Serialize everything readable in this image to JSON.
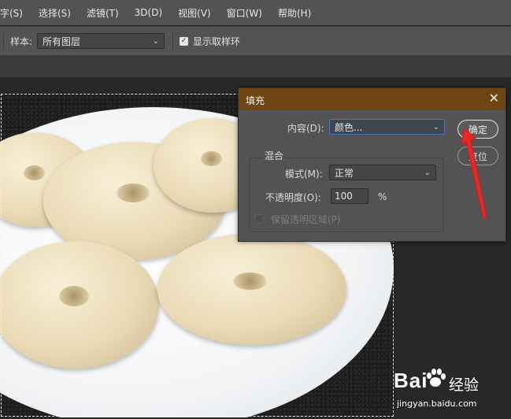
{
  "menubar": {
    "items": [
      {
        "label": "字(S)"
      },
      {
        "label": "选择(S)"
      },
      {
        "label": "滤镜(T)"
      },
      {
        "label": "3D(D)"
      },
      {
        "label": "视图(V)"
      },
      {
        "label": "窗口(W)"
      },
      {
        "label": "帮助(H)"
      }
    ]
  },
  "options": {
    "sample_label": "样本:",
    "sample_value": "所有图层",
    "show_ring_label": "显示取样环",
    "show_ring_checked": true
  },
  "dialog": {
    "title": "填充",
    "content_label": "内容(D):",
    "content_value": "颜色...",
    "blend_group_title": "混合",
    "mode_label": "模式(M):",
    "mode_value": "正常",
    "opacity_label": "不透明度(O):",
    "opacity_value": "100",
    "opacity_unit": "%",
    "preserve_label": "保留透明区域(P)",
    "preserve_checked": false,
    "ok_label": "确定",
    "reset_label": "复位"
  },
  "watermark": {
    "brand": "Bai",
    "brand_cn": "经验",
    "url": "jingyan.baidu.com"
  },
  "colors": {
    "title_bar": "#6e4513",
    "annotation_arrow": "#e8272a",
    "panel": "#535353"
  }
}
